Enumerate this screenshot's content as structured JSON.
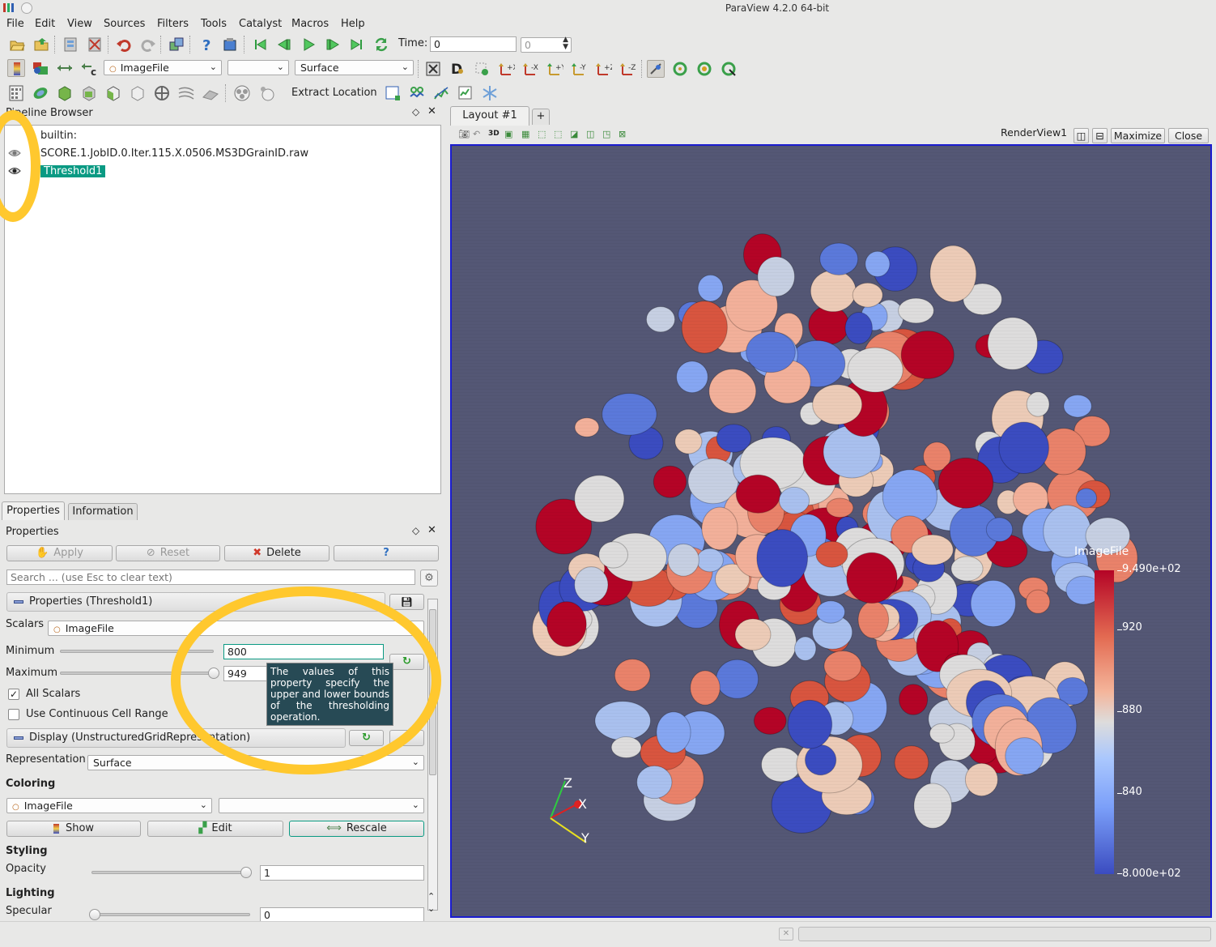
{
  "window": {
    "title": "ParaView 4.2.0 64-bit"
  },
  "menu": [
    "File",
    "Edit",
    "View",
    "Sources",
    "Filters",
    "Tools",
    "Catalyst",
    "Macros",
    "Help"
  ],
  "toolbar": {
    "time_label": "Time:",
    "time_value": "0",
    "timestep_value": "0",
    "color_array": "ImageFile",
    "representation": "Surface",
    "extract_location": "Extract Location"
  },
  "pipeline": {
    "title": "Pipeline Browser",
    "items": [
      {
        "label": "builtin:",
        "selected": false
      },
      {
        "label": "SCORE.1.JobID.0.Iter.115.X.0506.MS3DGrainID.raw",
        "selected": false
      },
      {
        "label": "Threshold1",
        "selected": true
      }
    ]
  },
  "tabs": {
    "properties": "Properties",
    "information": "Information"
  },
  "properties": {
    "title": "Properties",
    "apply": "Apply",
    "reset": "Reset",
    "delete": "Delete",
    "help": "?",
    "search_placeholder": "Search ... (use Esc to clear text)",
    "section_filter": "Properties (Threshold1)",
    "scalars_label": "Scalars",
    "scalars_value": "ImageFile",
    "minimum_label": "Minimum",
    "minimum_value": "800",
    "maximum_label": "Maximum",
    "maximum_value": "949",
    "minimum_fraction": 0.0,
    "maximum_fraction": 1.0,
    "all_scalars_label": "All Scalars",
    "all_scalars_checked": true,
    "continuous_label": "Use Continuous Cell Range",
    "continuous_checked": false,
    "tooltip": "The values of this property specify the upper and lower bounds of the thresholding operation.",
    "section_display": "Display (UnstructuredGridRepresentation)",
    "representation_label": "Representation",
    "representation_value": "Surface",
    "coloring_header": "Coloring",
    "coloring_value": "ImageFile",
    "show": "Show",
    "edit": "Edit",
    "rescale": "Rescale",
    "styling_header": "Styling",
    "opacity_label": "Opacity",
    "opacity_value": "1",
    "lighting_header": "Lighting",
    "specular_label": "Specular",
    "specular_value": "0"
  },
  "layout": {
    "tab": "Layout #1",
    "add_tab": "+",
    "view_name": "RenderView1",
    "maximize": "Maximize",
    "close": "Close",
    "threed": "3D"
  },
  "colorbar": {
    "title": "ImageFile",
    "max_label": "9.490e+02",
    "labels": [
      "920",
      "880",
      "840"
    ],
    "min_label": "8.000e+02",
    "colors": {
      "high": "#b40426",
      "mid": "#dddcdc",
      "low": "#3b4cc0"
    }
  },
  "axes": {
    "x": "X",
    "y": "Y",
    "z": "Z"
  },
  "colors": {
    "render_bg": "#545775",
    "highlight": "#0a9a83",
    "annotation": "#ffc82e"
  }
}
